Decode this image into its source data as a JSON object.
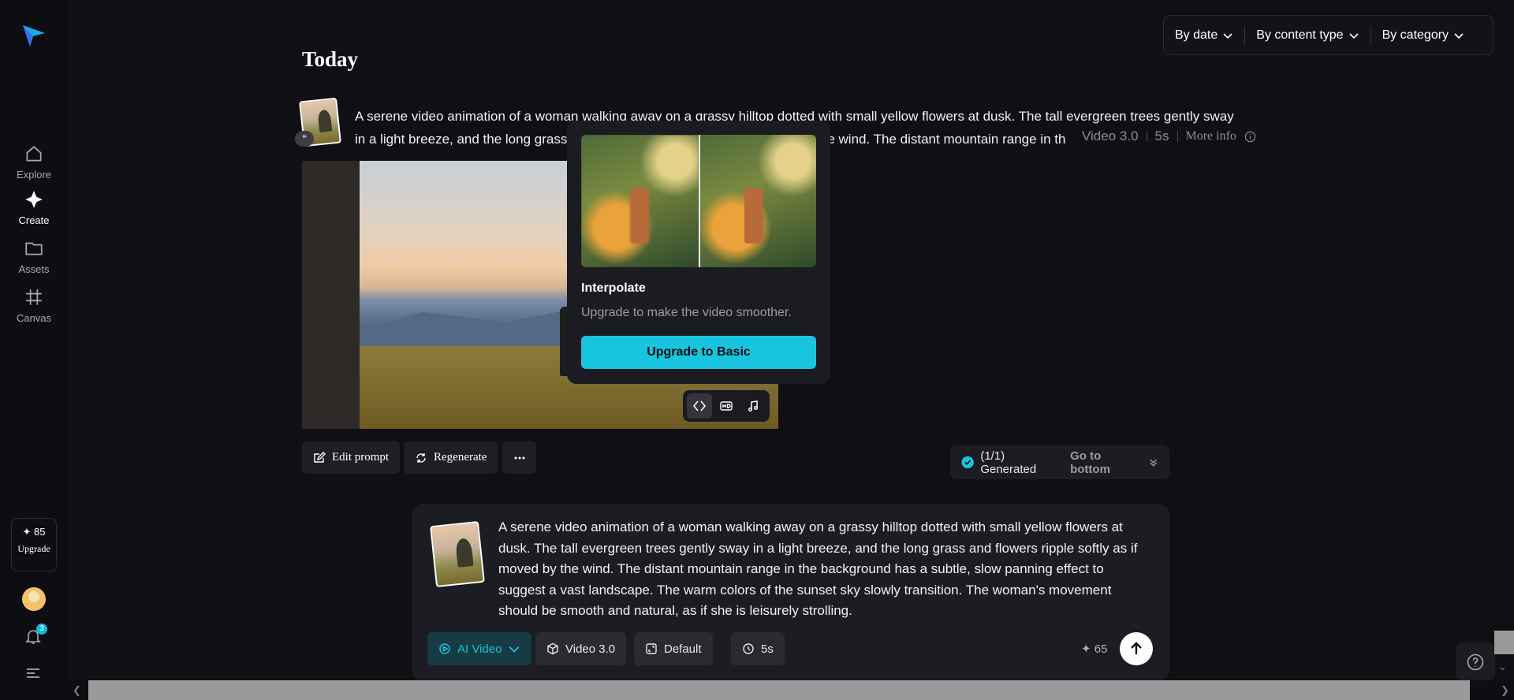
{
  "sidebar": {
    "items": [
      {
        "label": "Explore",
        "icon": "home-icon"
      },
      {
        "label": "Create",
        "icon": "sparkle-icon"
      },
      {
        "label": "Assets",
        "icon": "folder-icon"
      },
      {
        "label": "Canvas",
        "icon": "frame-icon"
      }
    ],
    "credits": "✦ 85",
    "upgrade": "Upgrade",
    "notifications": "3"
  },
  "filters": {
    "by_date": "By date",
    "by_content": "By content type",
    "by_category": "By category"
  },
  "section_title": "Today",
  "prompt": {
    "text_line1": "A serene video animation of a woman walking away on a grassy hilltop dotted with small yellow flowers at dusk. The tall evergreen trees gently sway",
    "text_line2_start": "in a light breeze, and the long grass",
    "text_line2_end": "e wind. The distant mountain range in th",
    "model": "Video 3.0",
    "duration": "5s",
    "more_info": "More info"
  },
  "popover": {
    "title": "Interpolate",
    "description": "Upgrade to make the video smoother.",
    "button": "Upgrade to Basic"
  },
  "actions": {
    "edit_prompt": "Edit prompt",
    "regenerate": "Regenerate",
    "generated": "(1/1) Generated",
    "go_bottom": "Go to bottom"
  },
  "composer": {
    "text": "A serene video animation of a woman walking away on a grassy hilltop dotted with small yellow flowers at dusk. The tall evergreen trees gently sway in a light breeze, and the long grass and flowers ripple softly as if moved by the wind. The distant mountain range in the background has a subtle, slow panning effect to suggest a vast landscape. The warm colors of the sunset sky slowly transition. The woman's movement should be smooth and natural, as if she is leisurely strolling.",
    "mode": "AI Video",
    "model": "Video 3.0",
    "ratio": "Default",
    "duration": "5s",
    "credits": "✦ 65"
  },
  "colors": {
    "accent": "#19c4df",
    "background": "#101014",
    "panel": "#1c1d22"
  }
}
